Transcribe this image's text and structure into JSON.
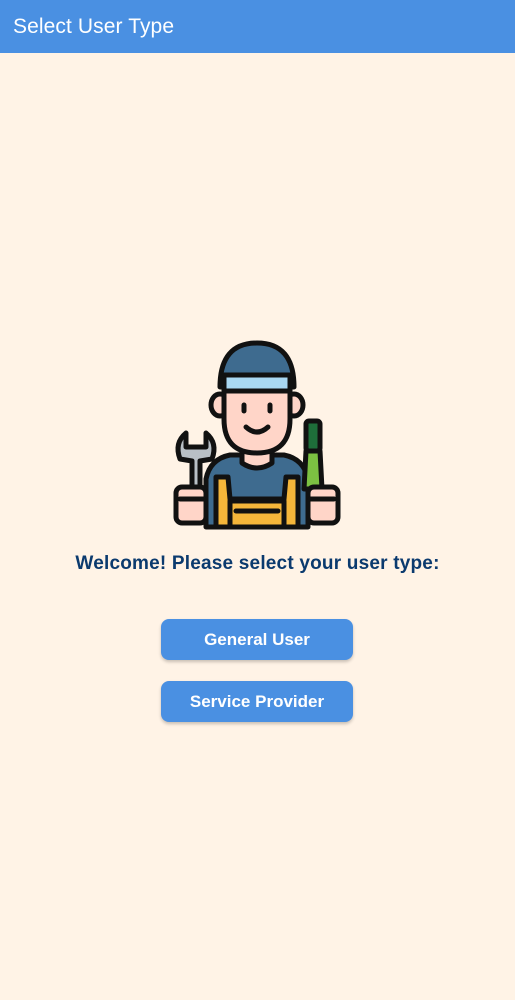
{
  "app_bar": {
    "title": "Select User Type",
    "color": "#4A90E2"
  },
  "illustration": {
    "icon": "mechanic-worker-icon"
  },
  "main": {
    "welcome_text": "Welcome! Please select your user type:",
    "buttons": [
      {
        "label": "General User"
      },
      {
        "label": "Service Provider"
      }
    ]
  },
  "colors": {
    "background": "#FFF3E6",
    "accent": "#4A90E2",
    "heading": "#0B3A6E"
  }
}
